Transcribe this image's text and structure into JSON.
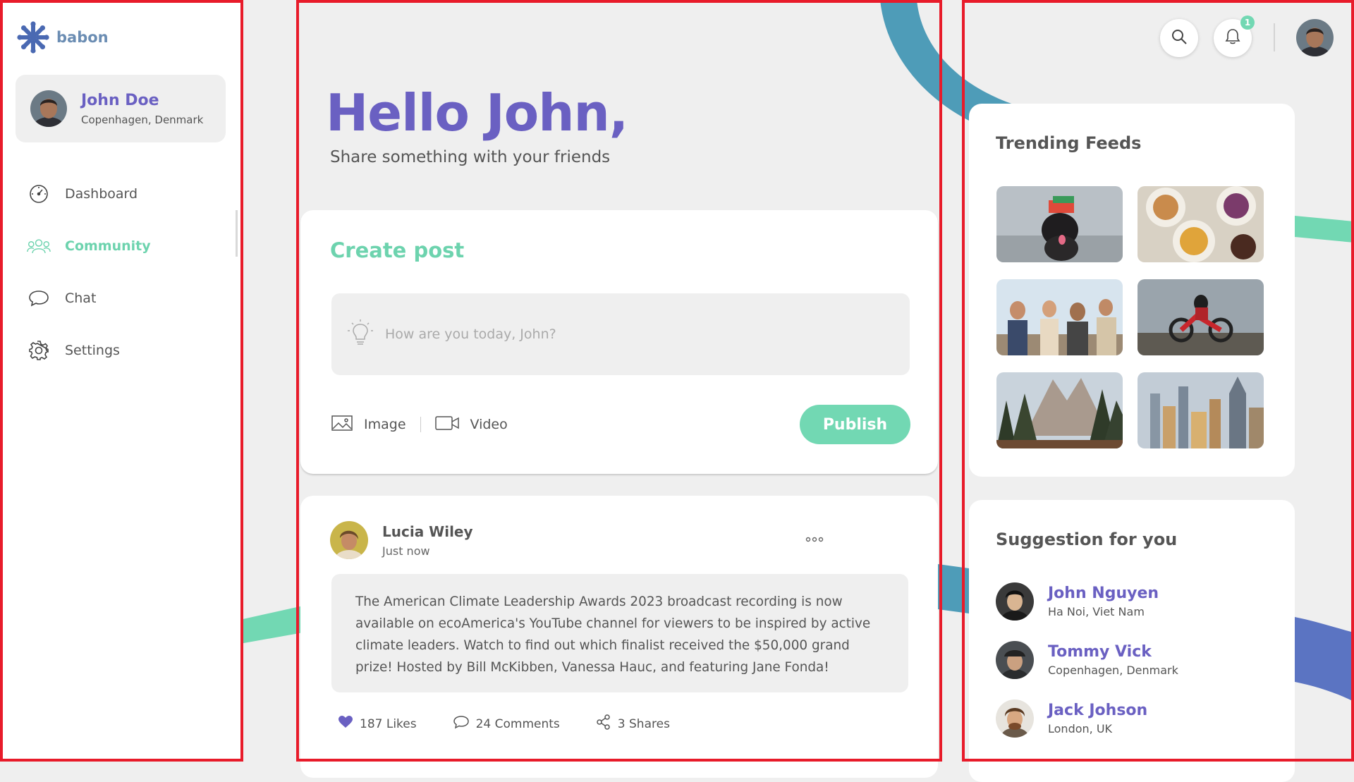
{
  "app": {
    "brand": "babon"
  },
  "colors": {
    "brand": "#6a60c2",
    "accent": "#6dd3ae",
    "publish": "#72d8b3",
    "background": "#efefef"
  },
  "sidebar": {
    "profile": {
      "name": "John Doe",
      "location": "Copenhagen, Denmark"
    },
    "nav": [
      {
        "label": "Dashboard",
        "icon": "dashboard-icon",
        "active": false
      },
      {
        "label": "Community",
        "icon": "community-icon",
        "active": true
      },
      {
        "label": "Chat",
        "icon": "chat-icon",
        "active": false
      },
      {
        "label": "Settings",
        "icon": "settings-icon",
        "active": false
      }
    ]
  },
  "header": {
    "notifications_count": "1"
  },
  "main": {
    "greeting": "Hello John,",
    "subgreeting": "Share something with your friends",
    "create_post": {
      "title": "Create post",
      "placeholder": "How are you today, John?",
      "image_label": "Image",
      "video_label": "Video",
      "publish_label": "Publish"
    },
    "post": {
      "author": "Lucia Wiley",
      "time": "Just now",
      "body": "The American Climate Leadership Awards 2023 broadcast recording is now available on ecoAmerica's YouTube channel for viewers to be inspired by active climate leaders. Watch to find out which finalist received the $50,000 grand prize! Hosted by Bill McKibben, Vanessa Hauc, and featuring Jane Fonda!",
      "likes": "187 Likes",
      "comments": "24 Comments",
      "shares": "3 Shares"
    }
  },
  "right": {
    "trending_title": "Trending Feeds",
    "trending": [
      {
        "subject": "dog"
      },
      {
        "subject": "food"
      },
      {
        "subject": "friends"
      },
      {
        "subject": "motocross"
      },
      {
        "subject": "mountains"
      },
      {
        "subject": "city"
      }
    ],
    "suggestion_title": "Suggestion for you",
    "suggestions": [
      {
        "name": "John Nguyen",
        "location": "Ha Noi, Viet Nam"
      },
      {
        "name": "Tommy Vick",
        "location": "Copenhagen, Denmark"
      },
      {
        "name": "Jack Johson",
        "location": "London, UK"
      }
    ]
  }
}
